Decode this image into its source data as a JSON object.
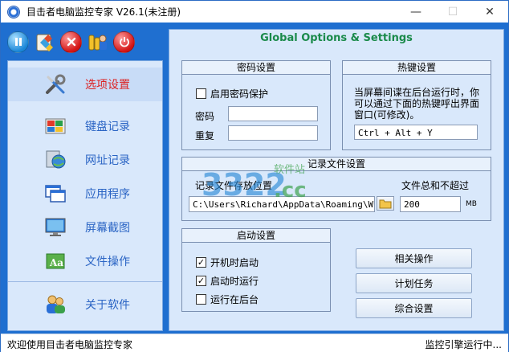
{
  "window": {
    "title": "目击者电脑监控专家 V26.1(未注册)",
    "controls": {
      "minimize": "—",
      "maximize": "☐",
      "close": "✕"
    }
  },
  "toolbar": {
    "icons": [
      "pause-icon",
      "settings-icon",
      "stop-icon",
      "users-icon",
      "power-icon"
    ]
  },
  "sidebar": {
    "items": [
      {
        "label": "选项设置",
        "icon": "tools-icon",
        "active": true
      },
      {
        "label": "键盘记录",
        "icon": "keyboard-icon",
        "active": false
      },
      {
        "label": "网址记录",
        "icon": "globe-icon",
        "active": false
      },
      {
        "label": "应用程序",
        "icon": "window-icon",
        "active": false
      },
      {
        "label": "屏幕截图",
        "icon": "monitor-icon",
        "active": false
      },
      {
        "label": "文件操作",
        "icon": "file-text-icon",
        "active": false
      },
      {
        "label": "关于软件",
        "icon": "users-icon",
        "active": false
      }
    ]
  },
  "main": {
    "header": "Global Options & Settings",
    "password": {
      "title": "密码设置",
      "enable_label": "启用密码保护",
      "enabled": false,
      "password_label": "密码",
      "confirm_label": "重复",
      "password_value": "",
      "confirm_value": ""
    },
    "hotkey": {
      "title": "热键设置",
      "hint": "当屏幕间谍在后台运行时，你可以通过下面的热键呼出界面窗口(可修改)。",
      "value": "Ctrl + Alt + Y"
    },
    "logfile": {
      "title": "记录文件设置",
      "location_label": "记录文件存放位置",
      "location_value": "C:\\Users\\Richard\\AppData\\Roaming\\Witso",
      "total_label": "文件总和不超过",
      "total_value": "200",
      "unit": "MB"
    },
    "startup": {
      "title": "启动设置",
      "options": [
        {
          "label": "开机时启动",
          "checked": true
        },
        {
          "label": "启动时运行",
          "checked": true
        },
        {
          "label": "运行在后台",
          "checked": false
        }
      ]
    },
    "buttons": {
      "related": "相关操作",
      "schedule": "计划任务",
      "general": "综合设置"
    }
  },
  "statusbar": {
    "left": "欢迎使用目击者电脑监控专家",
    "right": "监控引擎运行中..."
  },
  "watermark": {
    "text1": "3322",
    "text2": "软件站",
    "text3": ".cc"
  },
  "colors": {
    "accent": "#1f6fd0",
    "panel": "#d9e8fb",
    "header_text": "#1a8a4a",
    "active_label": "#dd2222"
  }
}
